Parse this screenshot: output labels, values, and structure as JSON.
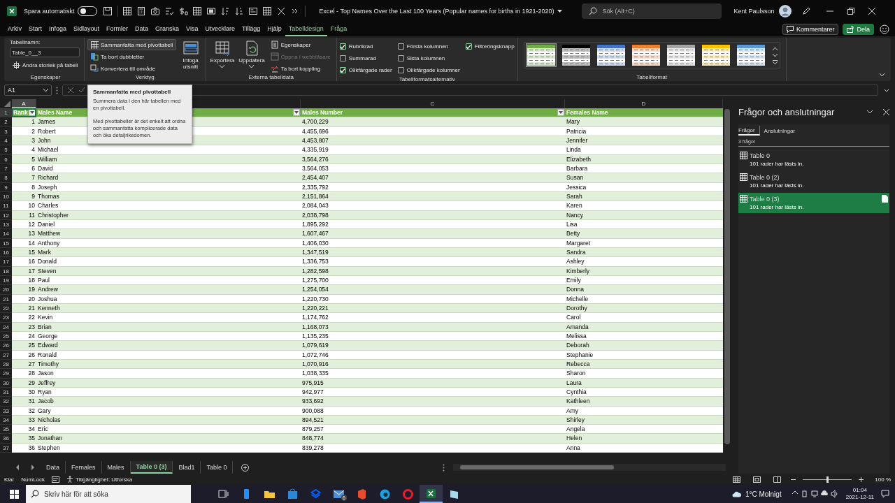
{
  "title_bar": {
    "autosave_label": "Spara automatiskt",
    "autosave_on": false,
    "title": "Excel - Top Names Over the Last 100 Years (Popular names for births in 1921-2020)",
    "search": {
      "placeholder": "Sök (Alt+C)"
    },
    "user": "Kent Paulsson"
  },
  "menu_tabs": [
    {
      "label": "Arkiv",
      "selected": false,
      "contextual": false
    },
    {
      "label": "Start",
      "selected": false,
      "contextual": false
    },
    {
      "label": "Infoga",
      "selected": false,
      "contextual": false
    },
    {
      "label": "Sidlayout",
      "selected": false,
      "contextual": false
    },
    {
      "label": "Formler",
      "selected": false,
      "contextual": false
    },
    {
      "label": "Data",
      "selected": false,
      "contextual": false
    },
    {
      "label": "Granska",
      "selected": false,
      "contextual": false
    },
    {
      "label": "Visa",
      "selected": false,
      "contextual": false
    },
    {
      "label": "Utvecklare",
      "selected": false,
      "contextual": false
    },
    {
      "label": "Tillägg",
      "selected": false,
      "contextual": false
    },
    {
      "label": "Hjälp",
      "selected": false,
      "contextual": false
    },
    {
      "label": "Tabelldesign",
      "selected": true,
      "contextual": true
    },
    {
      "label": "Fråga",
      "selected": false,
      "contextual": true
    }
  ],
  "actions": [
    {
      "kind": "comment",
      "label": "Kommentarer"
    },
    {
      "kind": "share",
      "label": "Dela"
    }
  ],
  "ribbon": {
    "properties": {
      "title": "Egenskaper",
      "name_label": "Tabellnamn:",
      "name_value": "Table_0__3",
      "resize": "Ändra storlek på tabell"
    },
    "tools": {
      "title": "Verktyg",
      "items": [
        {
          "label": "Sammanfatta med pivottabell",
          "hovered": true
        },
        {
          "label": "Ta bort dubbletter",
          "hovered": false
        },
        {
          "label": "Konvertera till område",
          "hovered": false
        }
      ],
      "slicer": "Infoga utsnitt"
    },
    "external": {
      "title": "Externa tabelldata",
      "large": [
        {
          "label": "Exportera"
        },
        {
          "label": "Uppdatera"
        }
      ],
      "items": [
        {
          "label": "Egenskaper",
          "disabled": false
        },
        {
          "label": "Öppna i webbläsare",
          "disabled": true
        },
        {
          "label": "Ta bort koppling",
          "disabled": false
        }
      ]
    },
    "style_options": {
      "title": "Tabellformatsalternativ",
      "options": [
        {
          "label": "Rubrikrad",
          "checked": true
        },
        {
          "label": "Summarad",
          "checked": false
        },
        {
          "label": "Olikfärgade rader",
          "checked": true
        },
        {
          "label": "Första kolumnen",
          "checked": false
        },
        {
          "label": "Sista kolumnen",
          "checked": false
        },
        {
          "label": "Olikfärgade kolumner",
          "checked": false
        },
        {
          "label": "Filtreringsknapp",
          "checked": true
        }
      ]
    },
    "styles": {
      "title": "Tabellformat",
      "swatches": [
        {
          "color": "#70ad47",
          "selected": true
        },
        {
          "color": "#000000",
          "selected": false
        },
        {
          "color": "#4472c4",
          "selected": false
        },
        {
          "color": "#ed7d31",
          "selected": false
        },
        {
          "color": "#a5a5a5",
          "selected": false
        },
        {
          "color": "#ffc000",
          "selected": false
        },
        {
          "color": "#5b9bd5",
          "selected": false
        }
      ]
    }
  },
  "formula_bar": {
    "name_box": "A1"
  },
  "sheet": {
    "columns": [
      {
        "letter": "A",
        "selected": true
      },
      {
        "selected": false
      },
      {
        "letter": "C",
        "selected": false
      },
      {
        "letter": "D",
        "selected": false
      }
    ],
    "header": {
      "row_number": "1",
      "selected": true,
      "cells": [
        "Rank",
        "Males Name",
        "Males Number",
        "Females Name"
      ],
      "filters": [
        true,
        true,
        true,
        false
      ]
    },
    "rows": [
      {
        "row_number": "2",
        "cells": [
          "1",
          "James",
          "4,700,229",
          "Mary"
        ]
      },
      {
        "row_number": "3",
        "cells": [
          "2",
          "Robert",
          "4,455,696",
          "Patricia"
        ]
      },
      {
        "row_number": "4",
        "cells": [
          "3",
          "John",
          "4,453,807",
          "Jennifer"
        ]
      },
      {
        "row_number": "5",
        "cells": [
          "4",
          "Michael",
          "4,335,919",
          "Linda"
        ]
      },
      {
        "row_number": "6",
        "cells": [
          "5",
          "William",
          "3,564,276",
          "Elizabeth"
        ]
      },
      {
        "row_number": "7",
        "cells": [
          "6",
          "David",
          "3,564,053",
          "Barbara"
        ]
      },
      {
        "row_number": "8",
        "cells": [
          "7",
          "Richard",
          "2,454,407",
          "Susan"
        ]
      },
      {
        "row_number": "9",
        "cells": [
          "8",
          "Joseph",
          "2,335,792",
          "Jessica"
        ]
      },
      {
        "row_number": "10",
        "cells": [
          "9",
          "Thomas",
          "2,151,864",
          "Sarah"
        ]
      },
      {
        "row_number": "11",
        "cells": [
          "10",
          "Charles",
          "2,084,043",
          "Karen"
        ]
      },
      {
        "row_number": "12",
        "cells": [
          "11",
          "Christopher",
          "2,038,798",
          "Nancy"
        ]
      },
      {
        "row_number": "13",
        "cells": [
          "12",
          "Daniel",
          "1,895,292",
          "Lisa"
        ]
      },
      {
        "row_number": "14",
        "cells": [
          "13",
          "Matthew",
          "1,607,467",
          "Betty"
        ]
      },
      {
        "row_number": "15",
        "cells": [
          "14",
          "Anthony",
          "1,406,030",
          "Margaret"
        ]
      },
      {
        "row_number": "16",
        "cells": [
          "15",
          "Mark",
          "1,347,519",
          "Sandra"
        ]
      },
      {
        "row_number": "17",
        "cells": [
          "16",
          "Donald",
          "1,336,753",
          "Ashley"
        ]
      },
      {
        "row_number": "18",
        "cells": [
          "17",
          "Steven",
          "1,282,598",
          "Kimberly"
        ]
      },
      {
        "row_number": "19",
        "cells": [
          "18",
          "Paul",
          "1,275,700",
          "Emily"
        ]
      },
      {
        "row_number": "20",
        "cells": [
          "19",
          "Andrew",
          "1,254,054",
          "Donna"
        ]
      },
      {
        "row_number": "21",
        "cells": [
          "20",
          "Joshua",
          "1,220,730",
          "Michelle"
        ]
      },
      {
        "row_number": "22",
        "cells": [
          "21",
          "Kenneth",
          "1,220,221",
          "Dorothy"
        ]
      },
      {
        "row_number": "23",
        "cells": [
          "22",
          "Kevin",
          "1,174,762",
          "Carol"
        ]
      },
      {
        "row_number": "24",
        "cells": [
          "23",
          "Brian",
          "1,168,073",
          "Amanda"
        ]
      },
      {
        "row_number": "25",
        "cells": [
          "24",
          "George",
          "1,135,235",
          "Melissa"
        ]
      },
      {
        "row_number": "26",
        "cells": [
          "25",
          "Edward",
          "1,079,619",
          "Deborah"
        ]
      },
      {
        "row_number": "27",
        "cells": [
          "26",
          "Ronald",
          "1,072,746",
          "Stephanie"
        ]
      },
      {
        "row_number": "28",
        "cells": [
          "27",
          "Timothy",
          "1,070,916",
          "Rebecca"
        ]
      },
      {
        "row_number": "29",
        "cells": [
          "28",
          "Jason",
          "1,038,335",
          "Sharon"
        ]
      },
      {
        "row_number": "30",
        "cells": [
          "29",
          "Jeffrey",
          "975,915",
          "Laura"
        ]
      },
      {
        "row_number": "31",
        "cells": [
          "30",
          "Ryan",
          "942,977",
          "Cynthia"
        ]
      },
      {
        "row_number": "32",
        "cells": [
          "31",
          "Jacob",
          "933,692",
          "Kathleen"
        ]
      },
      {
        "row_number": "33",
        "cells": [
          "32",
          "Gary",
          "900,088",
          "Amy"
        ]
      },
      {
        "row_number": "34",
        "cells": [
          "33",
          "Nicholas",
          "894,521",
          "Shirley"
        ]
      },
      {
        "row_number": "35",
        "cells": [
          "34",
          "Eric",
          "879,257",
          "Angela"
        ]
      },
      {
        "row_number": "36",
        "cells": [
          "35",
          "Jonathan",
          "848,774",
          "Helen"
        ]
      },
      {
        "row_number": "37",
        "cells": [
          "36",
          "Stephen",
          "839,278",
          "Anna"
        ]
      }
    ]
  },
  "tooltip": {
    "title": "Sammanfatta med pivottabell",
    "paragraphs": [
      "Summera data i den här tabellen med en pivottabell.",
      "Med pivottabeller är det enkelt att ordna och sammanfatta komplicerade data och öka detaljrikedomen."
    ]
  },
  "queries_pane": {
    "title": "Frågor och anslutningar",
    "tabs": [
      {
        "label": "Frågor",
        "selected": true
      },
      {
        "label": "Anslutningar",
        "selected": false
      }
    ],
    "count": "3 frågor",
    "queries": [
      {
        "name": "Table 0",
        "status": "101 rader har lästs in.",
        "selected": false
      },
      {
        "name": "Table 0 (2)",
        "status": "101 rader har lästs in.",
        "selected": false
      },
      {
        "name": "Table 0 (3)",
        "status": "101 rader har lästs in.",
        "selected": true
      }
    ]
  },
  "sheet_tabs": [
    {
      "label": "Data",
      "selected": false
    },
    {
      "label": "Females",
      "selected": false
    },
    {
      "label": "Males",
      "selected": false
    },
    {
      "label": "Table 0 (3)",
      "selected": true
    },
    {
      "label": "Blad1",
      "selected": false
    },
    {
      "label": "Table 0",
      "selected": false
    }
  ],
  "status_bar": {
    "ready": "Klar",
    "numlock": "NumLock",
    "accessibility": "Tillgänglighet: Utforska",
    "zoom": {
      "level": 0.5,
      "reading": "100 %"
    }
  },
  "taskbar": {
    "search": {
      "placeholder": "Skriv här för att söka"
    },
    "mail_badge": "6",
    "weather": "1°C Molnigt",
    "time": "01:04",
    "date": "2021-12-11"
  }
}
